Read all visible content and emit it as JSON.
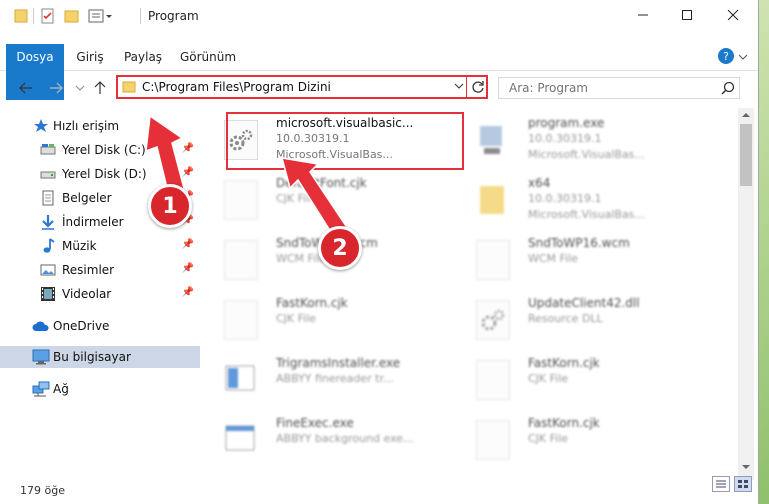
{
  "window": {
    "title": "Program",
    "minimize_icon": "minimize-icon",
    "maximize_icon": "maximize-icon",
    "close_icon": "close-icon"
  },
  "ribbon": {
    "tabs": [
      "Dosya",
      "Giriş",
      "Paylaş",
      "Görünüm"
    ],
    "accent": "#1979ca"
  },
  "address": {
    "path": "C:\\Program Files\\Program Dizini"
  },
  "search": {
    "placeholder": "Ara: Program"
  },
  "sidebar": {
    "quick_access": "Hızlı erişim",
    "items": [
      "Yerel Disk (C:)",
      "Yerel Disk (D:)",
      "Belgeler",
      "İndirmeler",
      "Müzik",
      "Resimler",
      "Videolar"
    ],
    "onedrive": "OneDrive",
    "this_pc": "Bu bilgisayar",
    "network": "Ağ"
  },
  "files": [
    {
      "name": "microsoft.visualbasic...",
      "line2": "10.0.30319.1",
      "line3": "Microsoft.VisualBas..."
    },
    {
      "name": "program.exe",
      "line2": "10.0.30319.1",
      "line3": "Microsoft.VisualBas..."
    },
    {
      "name": "DefaultFont.cjk",
      "line2": "CJK File",
      "line3": ""
    },
    {
      "name": "x64",
      "line2": "10.0.30319.1",
      "line3": "Microsoft.VisualBas..."
    },
    {
      "name": "SndToWP16.wcm",
      "line2": "WCM File",
      "line3": ""
    },
    {
      "name": "SndToWP16.wcm",
      "line2": "WCM File",
      "line3": ""
    },
    {
      "name": "FastKorn.cjk",
      "line2": "CJK File",
      "line3": ""
    },
    {
      "name": "UpdateClient42.dll",
      "line2": "Resource DLL",
      "line3": ""
    },
    {
      "name": "TrigramsInstaller.exe",
      "line2": "ABBYY finereader tr...",
      "line3": ""
    },
    {
      "name": "FastKorn.cjk",
      "line2": "CJK File",
      "line3": ""
    },
    {
      "name": "FineExec.exe",
      "line2": "ABBYY background exe...",
      "line3": ""
    },
    {
      "name": "FastKorn.cjk",
      "line2": "CJK File",
      "line3": ""
    }
  ],
  "status": {
    "count": "179 öğe"
  },
  "annotations": {
    "badge1": "1",
    "badge2": "2",
    "color": "#e53039"
  }
}
